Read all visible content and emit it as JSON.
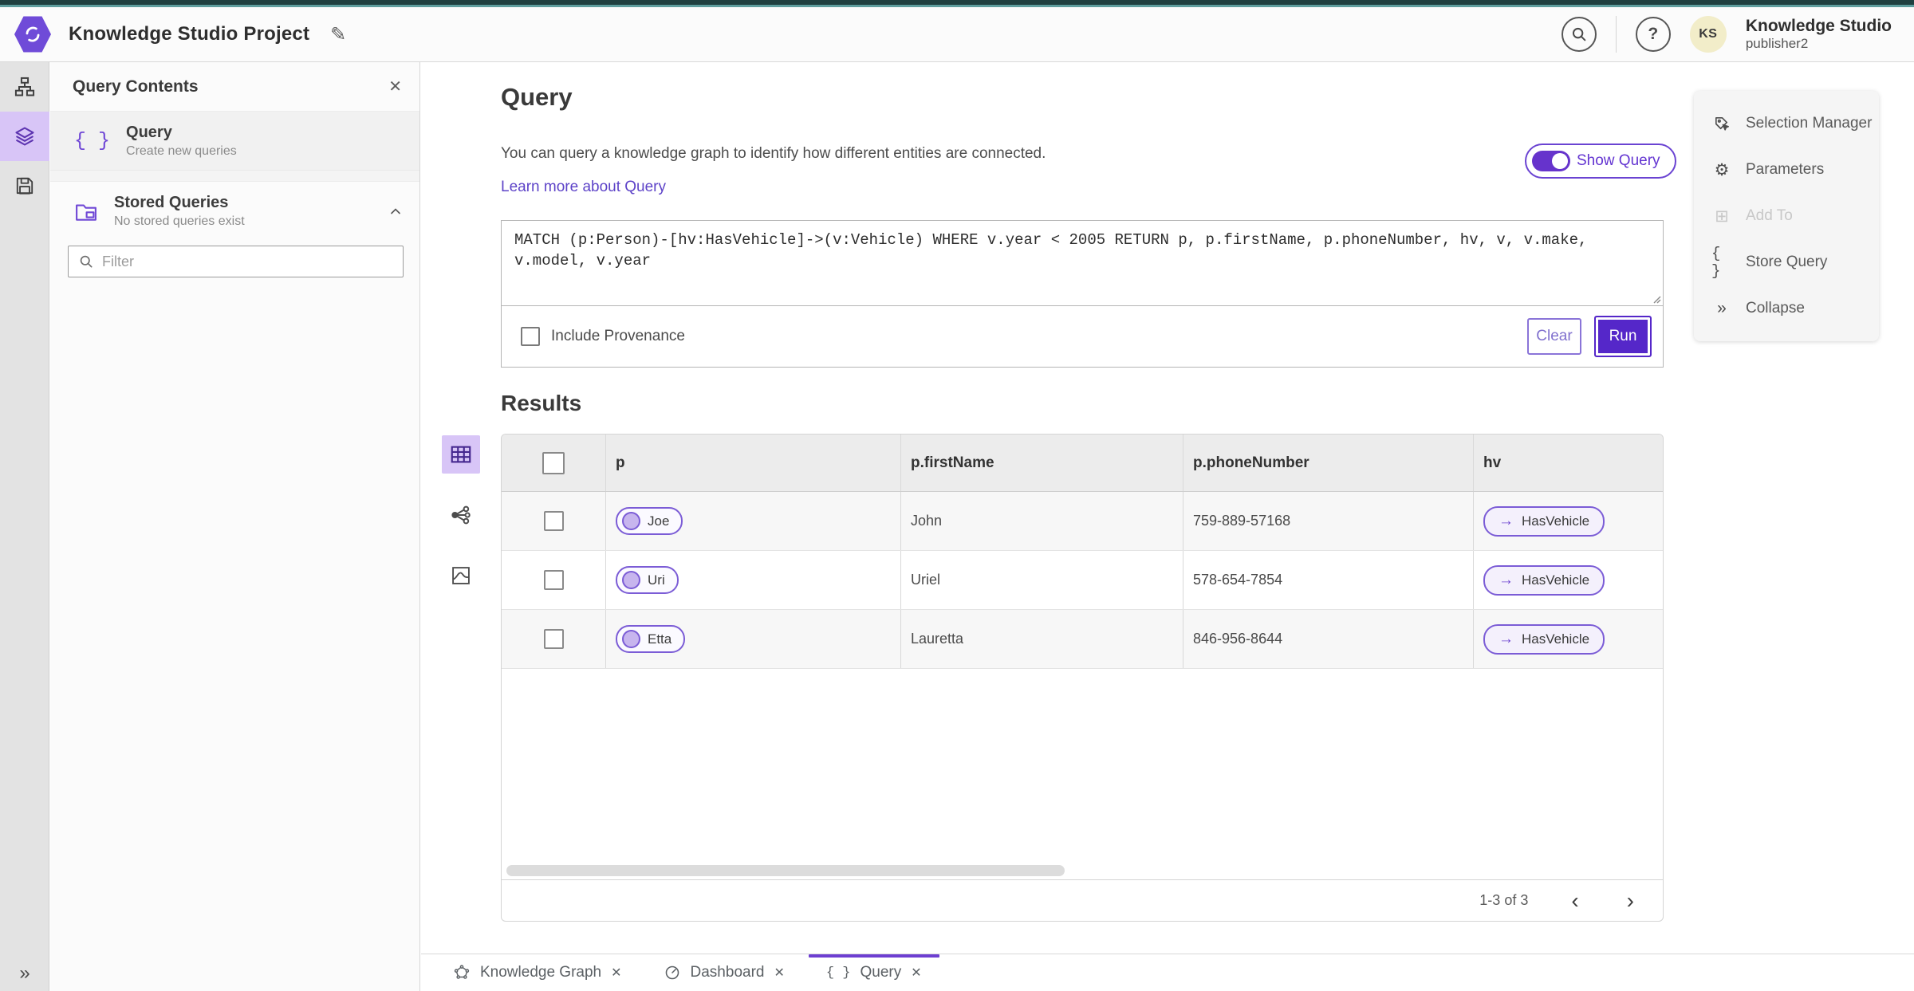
{
  "colors": {
    "accent": "#6d43d0",
    "accent_deep": "#5527c9",
    "selected_bg": "#d8c5f7",
    "teal_top": "#204040",
    "link": "#5d43c8"
  },
  "topbar": {
    "title": "Knowledge Studio Project",
    "user_initials": "KS",
    "user_name": "Knowledge Studio",
    "user_role": "publisher2"
  },
  "panel": {
    "title": "Query Contents",
    "query_item": {
      "title": "Query",
      "subtitle": "Create new queries"
    },
    "stored": {
      "title": "Stored Queries",
      "subtitle": "No stored queries exist"
    },
    "filter_placeholder": "Filter"
  },
  "query": {
    "heading": "Query",
    "description": "You can query a knowledge graph to identify how different entities are connected.",
    "learn_more": "Learn more about Query",
    "show_query": "Show Query",
    "text": "MATCH (p:Person)-[hv:HasVehicle]->(v:Vehicle) WHERE v.year < 2005 RETURN p, p.firstName, p.phoneNumber, hv, v, v.make, v.model, v.year",
    "include_provenance": "Include Provenance",
    "clear": "Clear",
    "run": "Run"
  },
  "results": {
    "heading": "Results",
    "columns": [
      "p",
      "p.firstName",
      "p.phoneNumber",
      "hv"
    ],
    "rows": [
      {
        "p": "Joe",
        "firstName": "John",
        "phone": "759-889-57168",
        "hv": "HasVehicle"
      },
      {
        "p": "Uri",
        "firstName": "Uriel",
        "phone": "578-654-7854",
        "hv": "HasVehicle"
      },
      {
        "p": "Etta",
        "firstName": "Lauretta",
        "phone": "846-956-8644",
        "hv": "HasVehicle"
      }
    ],
    "pagination": "1-3 of 3"
  },
  "right_panel": {
    "selection_manager": "Selection Manager",
    "parameters": "Parameters",
    "add_to": "Add To",
    "store_query": "Store Query",
    "collapse": "Collapse"
  },
  "tabs": [
    {
      "label": "Knowledge Graph"
    },
    {
      "label": "Dashboard"
    },
    {
      "label": "Query"
    }
  ],
  "icons": {
    "close": "✕",
    "pencil": "✎",
    "help": "?",
    "braces": "{ }",
    "gear": "⚙",
    "add_to": "⊞",
    "collapse": "»",
    "expand": "»",
    "arrow": "→",
    "prev": "‹",
    "next": "›"
  }
}
